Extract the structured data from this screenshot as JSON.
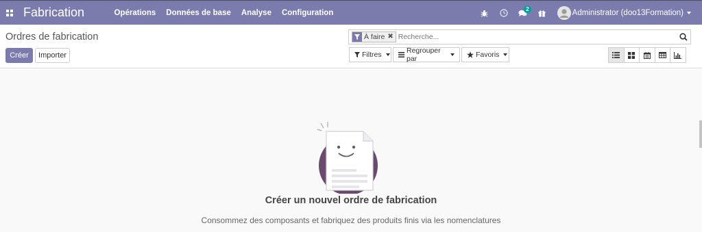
{
  "navbar": {
    "app_name": "Fabrication",
    "menu": [
      "Opérations",
      "Données de base",
      "Analyse",
      "Configuration"
    ],
    "chat_badge": "2",
    "user_name": "Administrator (doo13Formation)"
  },
  "control_panel": {
    "title": "Ordres de fabrication",
    "create_label": "Créer",
    "import_label": "Importer",
    "search": {
      "facet_label": "À faire",
      "placeholder": "Recherche..."
    },
    "filters_label": "Filtres",
    "groupby_label": "Regrouper par",
    "favorites_label": "Favoris",
    "views": [
      "list",
      "kanban",
      "calendar",
      "pivot",
      "graph"
    ],
    "active_view": "list"
  },
  "helper": {
    "title": "Créer un nouvel ordre de fabrication",
    "text": "Consommez des composants et fabriquez des produits finis via les nomenclatures"
  },
  "colors": {
    "brand": "#7c7bad",
    "helper_circle": "#6a4a6e"
  }
}
